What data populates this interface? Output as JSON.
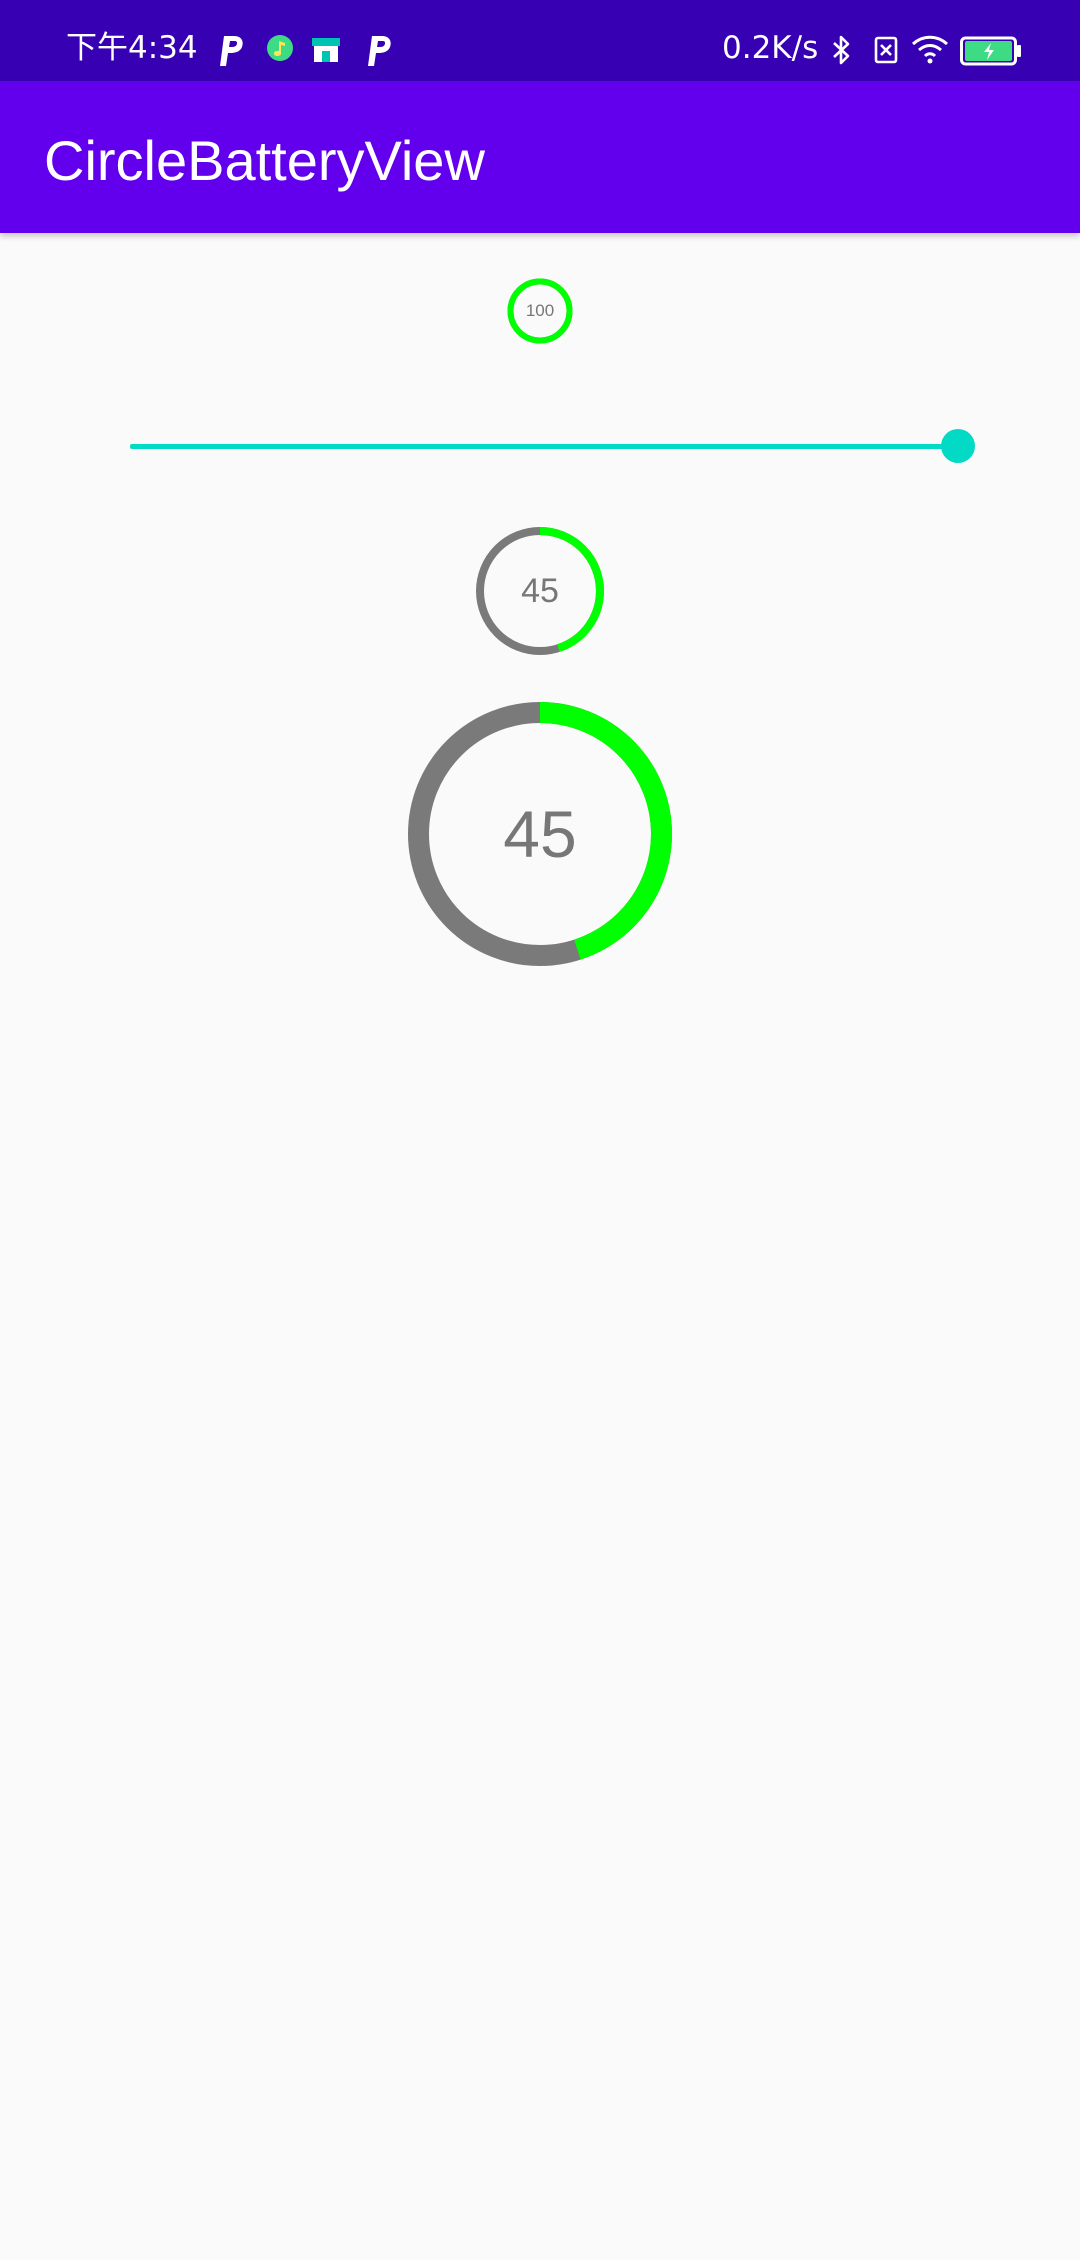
{
  "status_bar": {
    "time": "下午4:34",
    "network_speed": "0.2K/s",
    "icons": [
      "p-app-icon",
      "music-app-icon",
      "store-app-icon",
      "p-app-icon",
      "bluetooth-icon",
      "sim-disabled-icon",
      "wifi-icon",
      "battery-charging-icon"
    ],
    "background_color": "#3700b3"
  },
  "app_bar": {
    "title": "CircleBatteryView",
    "background_color": "#6200ee"
  },
  "battery_views": {
    "small": {
      "label": "100",
      "level": 100
    },
    "medium": {
      "label": "45",
      "level": 45
    },
    "large": {
      "label": "45",
      "level": 45
    }
  },
  "slider": {
    "value": 100,
    "max": 100,
    "color": "#03dac5"
  },
  "colors": {
    "ring_progress": "#00ff00",
    "ring_background": "#7a7a7a",
    "text": "#777777",
    "page_background": "#fafafa"
  }
}
